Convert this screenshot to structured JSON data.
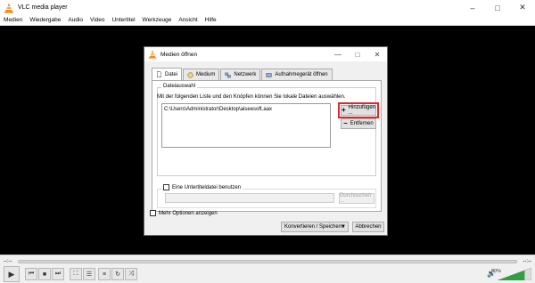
{
  "window": {
    "title": "VLC media player",
    "controls": [
      "–",
      "□",
      "✕"
    ]
  },
  "menu": [
    "Medien",
    "Wiedergabe",
    "Audio",
    "Video",
    "Untertitel",
    "Werkzeuge",
    "Ansicht",
    "Hilfe"
  ],
  "dialog": {
    "title": "Medien öffnen",
    "controls": [
      "—",
      "□",
      "✕"
    ],
    "tabs": [
      {
        "label": "Datei",
        "icon": "file-icon"
      },
      {
        "label": "Medium",
        "icon": "disc-icon"
      },
      {
        "label": "Netzwerk",
        "icon": "network-icon"
      },
      {
        "label": "Aufnahmegerät öffnen",
        "icon": "capture-device-icon"
      }
    ],
    "file_section": {
      "label": "Dateiauswahl",
      "hint": "Mit der folgenden Liste und den Knöpfen können Sie lokale Dateien auswählen.",
      "files": [
        "C:\\Users\\Administrator\\Desktop\\aiseesoft.aax"
      ],
      "add_button": "Hinzufügen ...",
      "remove_button": "Entfernen"
    },
    "subtitle": {
      "checkbox_label": "Eine Untertiteldatei benutzen",
      "browse_button": "Durchsuchen ..."
    },
    "more_options": "Mehr Optionen anzeigen",
    "convert_button": "Konvertieren / Speichern",
    "cancel_button": "Abbrechen",
    "highlight_color": "#e0262e"
  },
  "player": {
    "time_elapsed": "--:--",
    "time_total": "--:--",
    "volume": "80%",
    "volume_level": 0.8,
    "accent": "#2ea043"
  }
}
